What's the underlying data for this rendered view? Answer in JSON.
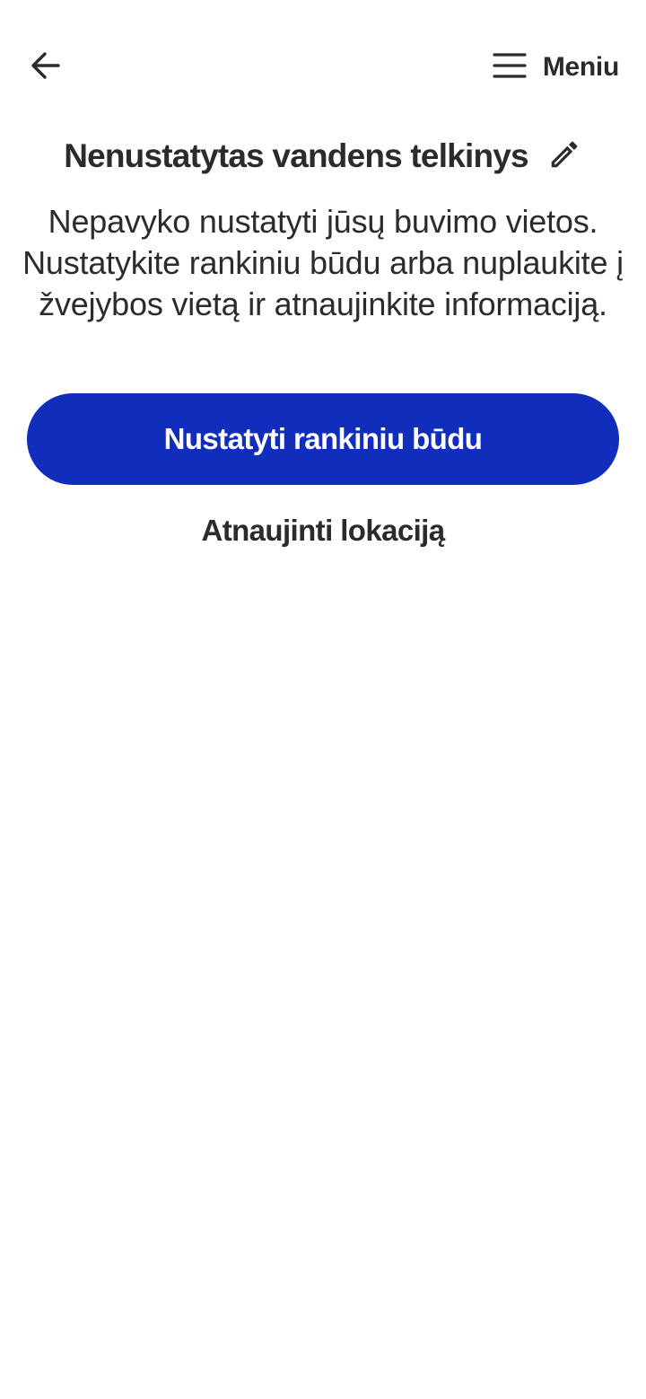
{
  "header": {
    "back_icon": "arrow-left-icon",
    "menu_icon": "hamburger-icon",
    "menu_label": "Meniu"
  },
  "location": {
    "title": "Nenustatytas vandens telkinys",
    "edit_icon": "pencil-icon",
    "message": "Nepavyko nustatyti jūsų buvimo vietos. Nustatykite rankiniu būdu arba nuplaukite į žvejybos vietą ir atnaujinkite informaciją."
  },
  "actions": {
    "primary_label": "Nustatyti rankiniu būdu",
    "secondary_label": "Atnaujinti lokaciją"
  },
  "colors": {
    "primary": "#102dbb",
    "text": "#2b2b2b",
    "background": "#ffffff"
  }
}
